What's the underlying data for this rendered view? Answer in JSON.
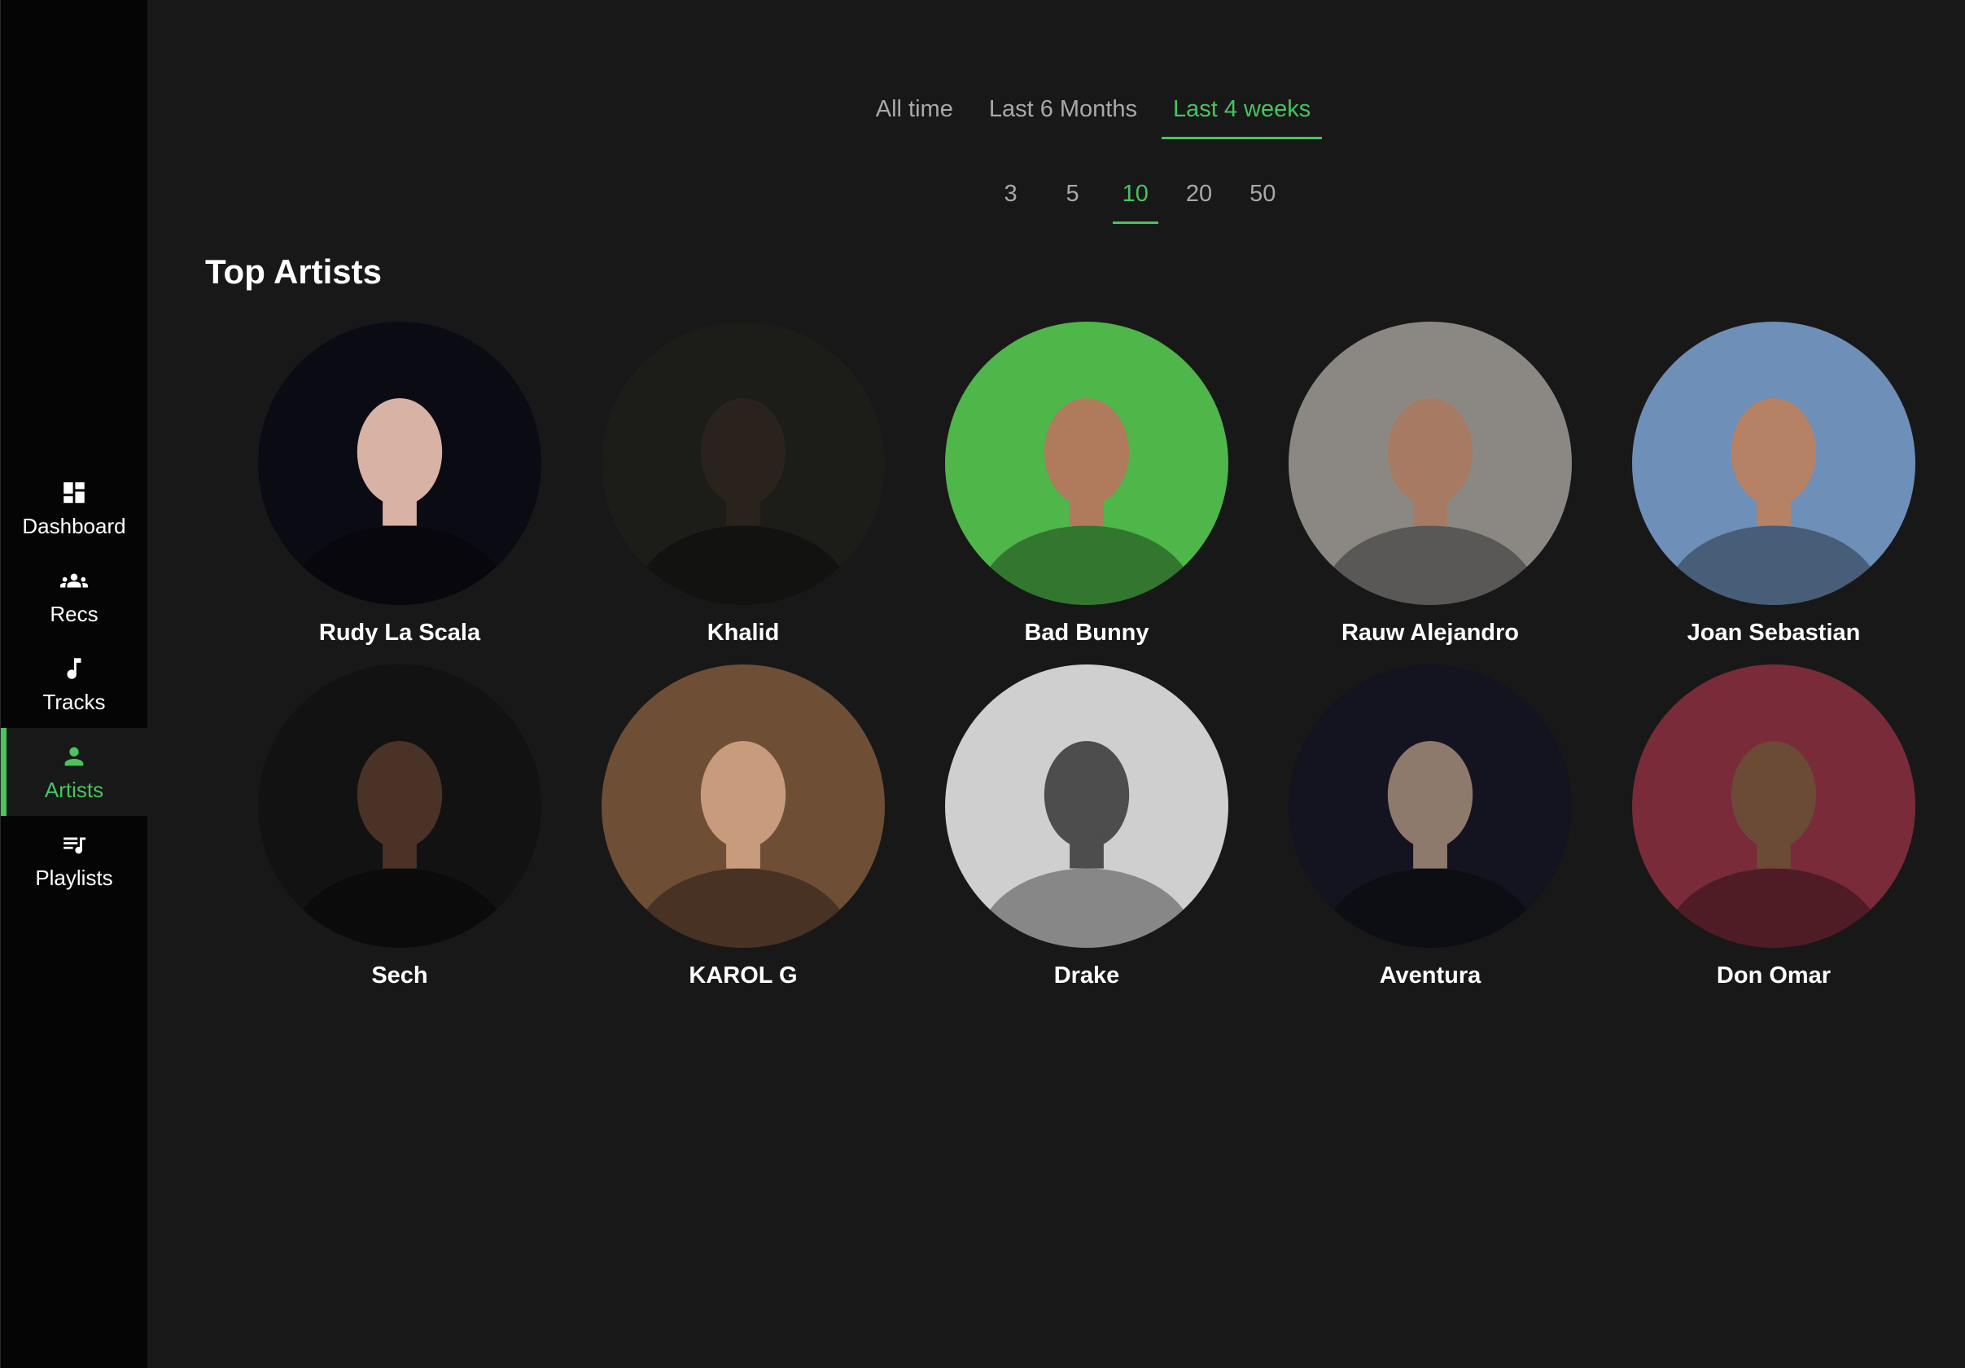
{
  "sidebar": {
    "items": [
      {
        "label": "Dashboard",
        "icon": "dashboard-icon",
        "active": false
      },
      {
        "label": "Recs",
        "icon": "people-icon",
        "active": false
      },
      {
        "label": "Tracks",
        "icon": "music-note-icon",
        "active": false
      },
      {
        "label": "Artists",
        "icon": "person-icon",
        "active": true
      },
      {
        "label": "Playlists",
        "icon": "playlist-icon",
        "active": false
      }
    ]
  },
  "range_tabs": [
    {
      "label": "All time",
      "active": false
    },
    {
      "label": "Last 6 Months",
      "active": false
    },
    {
      "label": "Last 4 weeks",
      "active": true
    }
  ],
  "limit_tabs": [
    {
      "label": "3",
      "active": false
    },
    {
      "label": "5",
      "active": false
    },
    {
      "label": "10",
      "active": true
    },
    {
      "label": "20",
      "active": false
    },
    {
      "label": "50",
      "active": false
    }
  ],
  "section": {
    "title": "Top Artists"
  },
  "artists": [
    {
      "name": "Rudy La Scala",
      "bg": "#0b0b14",
      "fg": "#d9b2a6"
    },
    {
      "name": "Khalid",
      "bg": "#1c1d19",
      "fg": "#2a231d"
    },
    {
      "name": "Bad Bunny",
      "bg": "#4fb64a",
      "fg": "#b07b5c"
    },
    {
      "name": "Rauw Alejandro",
      "bg": "#8b8884",
      "fg": "#a67a63"
    },
    {
      "name": "Joan Sebastian",
      "bg": "#6e8fb8",
      "fg": "#b58266"
    },
    {
      "name": "Sech",
      "bg": "#121212",
      "fg": "#4a3326"
    },
    {
      "name": "KAROL G",
      "bg": "#6f4e36",
      "fg": "#c79b7c"
    },
    {
      "name": "Drake",
      "bg": "#cfcfcf",
      "fg": "#4d4d4d"
    },
    {
      "name": "Aventura",
      "bg": "#141420",
      "fg": "#8e7a6c"
    },
    {
      "name": "Don Omar",
      "bg": "#7a2b3a",
      "fg": "#6b4a36"
    }
  ],
  "colors": {
    "accent": "#49c45e",
    "background": "#181818",
    "sidebar": "#050505",
    "muted_text": "#a9a9a9"
  }
}
